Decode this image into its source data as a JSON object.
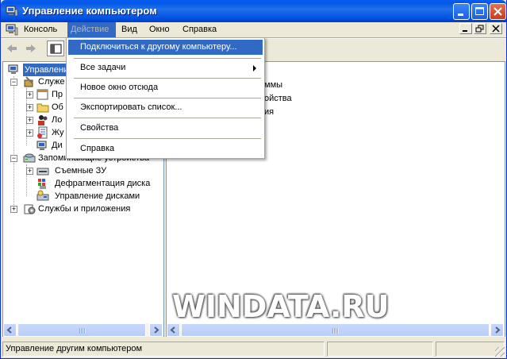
{
  "window": {
    "title": "Управление компьютером"
  },
  "menubar": {
    "items": [
      "Консоль",
      "Действие",
      "Вид",
      "Окно",
      "Справка"
    ],
    "active_index": 1
  },
  "action_menu": {
    "items": [
      {
        "label": "Подключиться к другому компьютеру...",
        "highlighted": true,
        "submenu": false
      },
      {
        "label": "Все задачи",
        "highlighted": false,
        "submenu": true
      },
      {
        "label": "Новое окно отсюда",
        "highlighted": false,
        "submenu": false
      },
      {
        "label": "Экспортировать список...",
        "highlighted": false,
        "submenu": false
      },
      {
        "label": "Свойства",
        "highlighted": false,
        "submenu": false
      },
      {
        "label": "Справка",
        "highlighted": false,
        "submenu": false
      }
    ]
  },
  "tree": {
    "root": "Управление",
    "service_group": "Служе",
    "service_children": [
      "Пр",
      "Об",
      "Ло",
      "Жу",
      "Ди"
    ],
    "storage_group": "Запоминающие устройства",
    "storage_children": [
      "Съемные ЗУ",
      "Дефрагментация диска",
      "Управление дисками"
    ],
    "apps_group": "Службы и приложения"
  },
  "right_pane": {
    "lines": [
      "ммы",
      "ойства",
      "ия"
    ]
  },
  "statusbar": {
    "text": "Управление другим компьютером"
  },
  "watermark": "WINDATA.RU",
  "colors": {
    "title_bar": "#0054e3",
    "menu_highlight": "#316ac5",
    "window_bg": "#ece9d8"
  }
}
